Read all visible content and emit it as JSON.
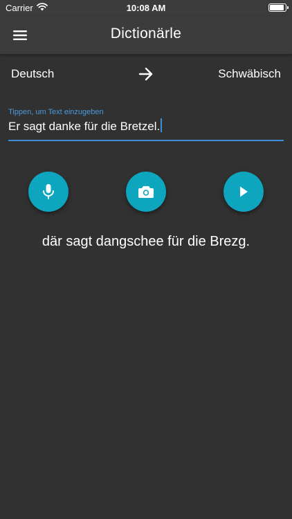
{
  "status_bar": {
    "carrier": "Carrier",
    "time": "10:08 AM"
  },
  "app_bar": {
    "title": "Dictionärle"
  },
  "languages": {
    "source": "Deutsch",
    "target": "Schwäbisch"
  },
  "input": {
    "label": "Tippen, um Text einzugeben",
    "value": "Er sagt danke für die Bretzel."
  },
  "result": {
    "text": "där sagt dangschee für die Brezg."
  },
  "colors": {
    "background": "#313131",
    "app_bar": "#3c3c3c",
    "accent_teal": "#0ea5be",
    "field_blue": "#3f8fd8"
  },
  "icons": {
    "menu": "menu-icon",
    "swap": "arrow-right-icon",
    "mic": "microphone-icon",
    "camera": "camera-icon",
    "play": "play-icon"
  }
}
